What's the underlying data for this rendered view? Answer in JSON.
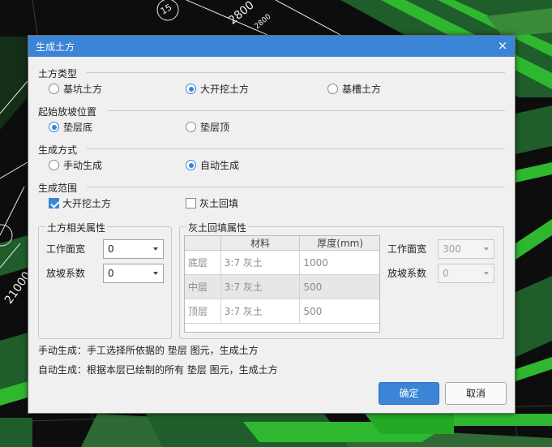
{
  "background": {
    "texts": [
      {
        "name": "cad-label-top-circle",
        "text": "15"
      },
      {
        "name": "cad-label-top-dim",
        "text": "2800"
      },
      {
        "name": "cad-label-top-dim-small",
        "text": "2800"
      },
      {
        "name": "cad-label-left-dim",
        "text": "21000"
      }
    ]
  },
  "dialog": {
    "title": "生成土方",
    "close_glyph": "×",
    "sections": {
      "earthwork_type": {
        "label": "土方类型",
        "options": [
          "基坑土方",
          "大开挖土方",
          "基槽土方"
        ],
        "selected": "大开挖土方"
      },
      "slope_start": {
        "label": "起始放坡位置",
        "options": [
          "垫层底",
          "垫层顶"
        ],
        "selected": "垫层底"
      },
      "generate_method": {
        "label": "生成方式",
        "options": [
          "手动生成",
          "自动生成"
        ],
        "selected": "自动生成"
      },
      "generate_scope": {
        "label": "生成范围",
        "options": [
          {
            "label": "大开挖土方",
            "checked": true
          },
          {
            "label": "灰土回填",
            "checked": false
          }
        ]
      }
    },
    "earthwork_props": {
      "title": "土方相关属性",
      "work_width_label": "工作面宽",
      "work_width_value": "0",
      "slope_coef_label": "放坡系数",
      "slope_coef_value": "0"
    },
    "backfill_props": {
      "title": "灰土回填属性",
      "columns": [
        "",
        "材料",
        "厚度(mm)"
      ],
      "rows": [
        {
          "layer": "底层",
          "material": "3:7 灰土",
          "thickness": "1000",
          "selected": false
        },
        {
          "layer": "中层",
          "material": "3:7 灰土",
          "thickness": "500",
          "selected": true
        },
        {
          "layer": "顶层",
          "material": "3:7 灰土",
          "thickness": "500",
          "selected": false
        }
      ],
      "work_width_label": "工作面宽",
      "work_width_value": "300",
      "slope_coef_label": "放坡系数",
      "slope_coef_value": "0",
      "disabled": true
    },
    "notes": [
      "手动生成：手工选择所依据的 垫层 图元，生成土方",
      "自动生成：根据本层已绘制的所有 垫层 图元，生成土方"
    ],
    "buttons": {
      "ok": "确定",
      "cancel": "取消"
    }
  },
  "colors": {
    "accent": "#3b84d6",
    "cad_background": "#0d0d0d",
    "cad_green": "#2fb82f",
    "cad_dark_green": "#1f5e2a"
  }
}
